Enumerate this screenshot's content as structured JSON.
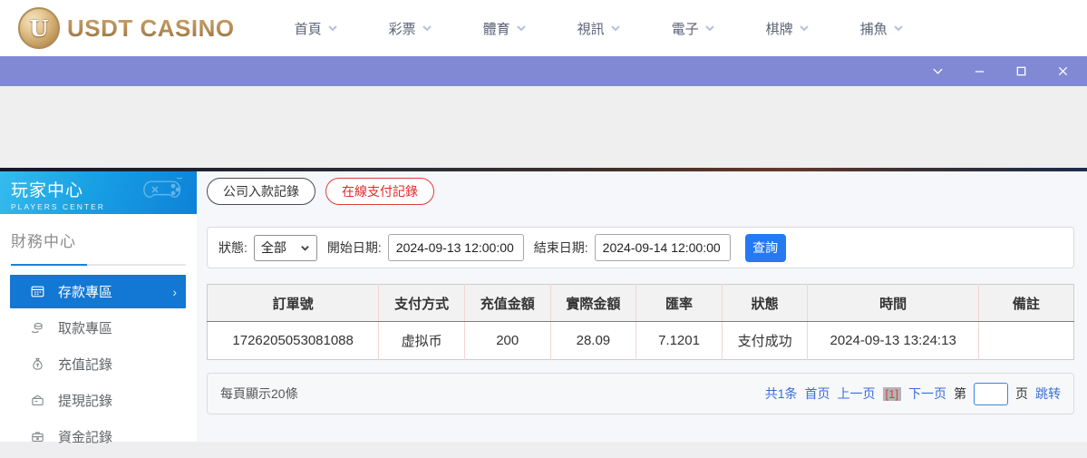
{
  "colors": {
    "titlebar": "#8189d5",
    "sidebar_active": "#1377d4",
    "query_button": "#2579f2",
    "link_blue": "#3a6fd8",
    "tab_active_red": "#e02a2a",
    "logo_gold": "#ab8050"
  },
  "header": {
    "logo_text": "USDT CASINO",
    "logo_letter": "U",
    "nav_items": [
      {
        "label": "首頁"
      },
      {
        "label": "彩票"
      },
      {
        "label": "體育"
      },
      {
        "label": "視訊"
      },
      {
        "label": "電子"
      },
      {
        "label": "棋牌"
      },
      {
        "label": "捕魚"
      }
    ]
  },
  "titlebar": {
    "icons": [
      "chevron-down",
      "minimize",
      "maximize",
      "close"
    ]
  },
  "sidebar": {
    "title": "玩家中心",
    "subtitle": "PLAYERS CENTER",
    "section_label": "財務中心",
    "items": [
      {
        "label": "存款專區",
        "icon": "deposit",
        "active": true
      },
      {
        "label": "取款專區",
        "icon": "withdraw",
        "active": false
      },
      {
        "label": "充值記錄",
        "icon": "recharge-record",
        "active": false
      },
      {
        "label": "提現記錄",
        "icon": "withdrawal-record",
        "active": false
      },
      {
        "label": "資金記錄",
        "icon": "funds-record",
        "active": false
      }
    ],
    "active_arrow": "›"
  },
  "main": {
    "tabs": [
      {
        "label": "公司入款記錄",
        "active": false
      },
      {
        "label": "在線支付記錄",
        "active": true
      }
    ],
    "filters": {
      "status_label": "狀態:",
      "status_value": "全部",
      "start_label": "開始日期:",
      "start_value": "2024-09-13 12:00:00",
      "end_label": "結束日期:",
      "end_value": "2024-09-14 12:00:00",
      "query_label": "查詢"
    },
    "table": {
      "headers": [
        "訂單號",
        "支付方式",
        "充值金額",
        "實際金額",
        "匯率",
        "狀態",
        "時間",
        "備註"
      ],
      "rows": [
        [
          "1726205053081088",
          "虚拟币",
          "200",
          "28.09",
          "7.1201",
          "支付成功",
          "2024-09-13 13:24:13",
          ""
        ]
      ]
    },
    "pagination": {
      "page_size_text": "每頁顯示20條",
      "total_text": "共1条",
      "first_label": "首页",
      "prev_label": "上一页",
      "current_page": "[1]",
      "next_label": "下一页",
      "jump_prefix": "第",
      "jump_suffix": "页",
      "jump_label": "跳转"
    }
  }
}
